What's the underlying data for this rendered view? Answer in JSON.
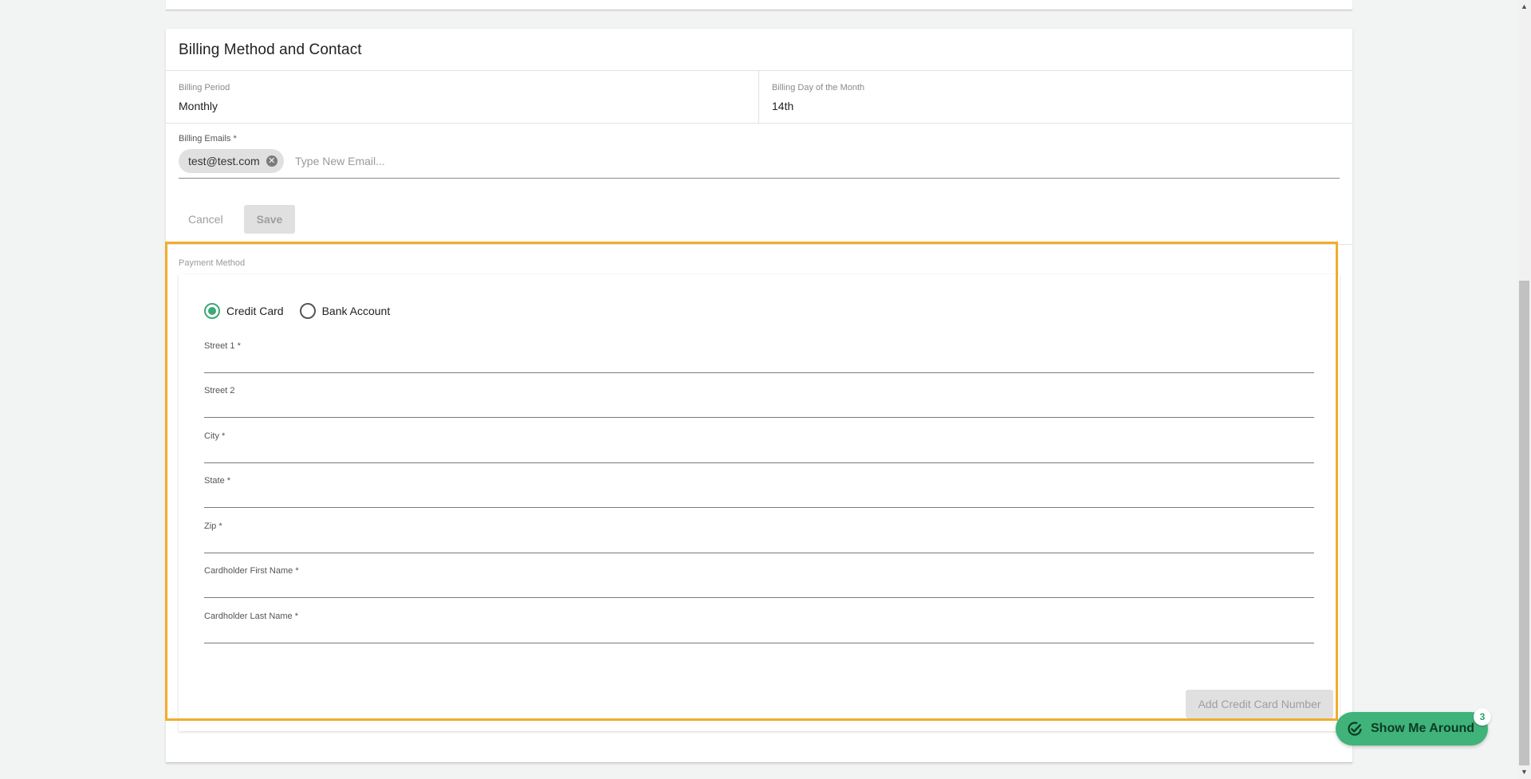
{
  "billing": {
    "title": "Billing Method and Contact",
    "period_label": "Billing Period",
    "period_value": "Monthly",
    "day_label": "Billing Day of the Month",
    "day_value": "14th",
    "emails_label": "Billing Emails *",
    "emails": [
      "test@test.com"
    ],
    "email_placeholder": "Type New Email...",
    "cancel_label": "Cancel",
    "save_label": "Save"
  },
  "payment": {
    "section_label": "Payment Method",
    "options": [
      {
        "label": "Credit Card",
        "selected": true
      },
      {
        "label": "Bank Account",
        "selected": false
      }
    ],
    "fields": [
      {
        "label": "Street 1 *",
        "value": ""
      },
      {
        "label": "Street 2",
        "value": ""
      },
      {
        "label": "City *",
        "value": ""
      },
      {
        "label": "State *",
        "value": ""
      },
      {
        "label": "Zip *",
        "value": ""
      },
      {
        "label": "Cardholder First Name *",
        "value": ""
      },
      {
        "label": "Cardholder Last Name *",
        "value": ""
      }
    ],
    "add_card_label": "Add Credit Card Number"
  },
  "tour": {
    "label": "Show Me Around",
    "badge": "3",
    "icon": "check-circle-icon"
  },
  "colors": {
    "accent_green": "#3fb37a",
    "highlight": "#f0ad2c",
    "radio_checked": "#3fa877"
  }
}
